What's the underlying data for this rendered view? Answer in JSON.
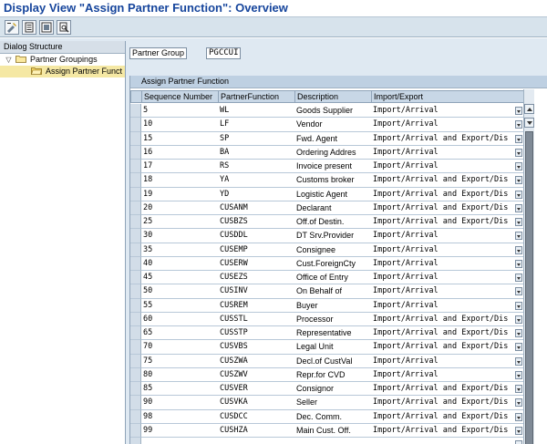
{
  "title": "Display View \"Assign Partner Function\": Overview",
  "toolbar": {
    "buttons": [
      "display-change-icon",
      "details-icon",
      "select-all-icon",
      "print-icon"
    ]
  },
  "dialog_structure": {
    "header": "Dialog Structure",
    "items": [
      {
        "label": "Partner Groupings",
        "level": 1,
        "expanded": true
      },
      {
        "label": "Assign Partner Funct",
        "level": 2,
        "selected": true
      }
    ]
  },
  "partner_group": {
    "label": "Partner Group",
    "value": "PGCCUI"
  },
  "table": {
    "title": "Assign Partner Function",
    "columns": [
      "Sequence Number",
      "PartnerFunction",
      "Description",
      "Import/Export"
    ],
    "rows": [
      {
        "seq": "5",
        "pf": "WL",
        "desc": "Goods Supplier",
        "ie": "Import/Arrival"
      },
      {
        "seq": "10",
        "pf": "LF",
        "desc": "Vendor",
        "ie": "Import/Arrival"
      },
      {
        "seq": "15",
        "pf": "SP",
        "desc": "Fwd. Agent",
        "ie": "Import/Arrival and Export/Dis"
      },
      {
        "seq": "16",
        "pf": "BA",
        "desc": "Ordering Addres",
        "ie": "Import/Arrival"
      },
      {
        "seq": "17",
        "pf": "RS",
        "desc": "Invoice present",
        "ie": "Import/Arrival"
      },
      {
        "seq": "18",
        "pf": "YA",
        "desc": "Customs broker",
        "ie": "Import/Arrival and Export/Dis"
      },
      {
        "seq": "19",
        "pf": "YD",
        "desc": "Logistic Agent",
        "ie": "Import/Arrival and Export/Dis"
      },
      {
        "seq": "20",
        "pf": "CUSANM",
        "desc": "Declarant",
        "ie": "Import/Arrival and Export/Dis"
      },
      {
        "seq": "25",
        "pf": "CUSBZS",
        "desc": "Off.of Destin.",
        "ie": "Import/Arrival and Export/Dis"
      },
      {
        "seq": "30",
        "pf": "CUSDDL",
        "desc": "DT Srv.Provider",
        "ie": "Import/Arrival"
      },
      {
        "seq": "35",
        "pf": "CUSEMP",
        "desc": "Consignee",
        "ie": "Import/Arrival"
      },
      {
        "seq": "40",
        "pf": "CUSERW",
        "desc": "Cust.ForeignCty",
        "ie": "Import/Arrival"
      },
      {
        "seq": "45",
        "pf": "CUSEZS",
        "desc": "Office of Entry",
        "ie": "Import/Arrival"
      },
      {
        "seq": "50",
        "pf": "CUSINV",
        "desc": "On Behalf of",
        "ie": "Import/Arrival"
      },
      {
        "seq": "55",
        "pf": "CUSREM",
        "desc": "Buyer",
        "ie": "Import/Arrival"
      },
      {
        "seq": "60",
        "pf": "CUSSTL",
        "desc": "Processor",
        "ie": "Import/Arrival and Export/Dis"
      },
      {
        "seq": "65",
        "pf": "CUSSTP",
        "desc": "Representative",
        "ie": "Import/Arrival and Export/Dis"
      },
      {
        "seq": "70",
        "pf": "CUSVBS",
        "desc": "Legal Unit",
        "ie": "Import/Arrival and Export/Dis"
      },
      {
        "seq": "75",
        "pf": "CUSZWA",
        "desc": "Decl.of CustVal",
        "ie": "Import/Arrival"
      },
      {
        "seq": "80",
        "pf": "CUSZWV",
        "desc": "Repr.for CVD",
        "ie": "Import/Arrival"
      },
      {
        "seq": "85",
        "pf": "CUSVER",
        "desc": "Consignor",
        "ie": "Import/Arrival and Export/Dis"
      },
      {
        "seq": "90",
        "pf": "CUSVKA",
        "desc": "Seller",
        "ie": "Import/Arrival and Export/Dis"
      },
      {
        "seq": "98",
        "pf": "CUSDCC",
        "desc": "Dec. Comm.",
        "ie": "Import/Arrival and Export/Dis"
      },
      {
        "seq": "99",
        "pf": "CUSHZA",
        "desc": "Main Cust. Off.",
        "ie": "Import/Arrival and Export/Dis"
      },
      {
        "seq": "",
        "pf": "",
        "desc": "",
        "ie": ""
      }
    ]
  },
  "colors": {
    "title": "#16459c",
    "toolbar_bg": "#d7e3ec",
    "table_title_bg": "#bed0e2",
    "header_bg": "#c8d7e6",
    "tree_selected": "#f5e8a4"
  }
}
